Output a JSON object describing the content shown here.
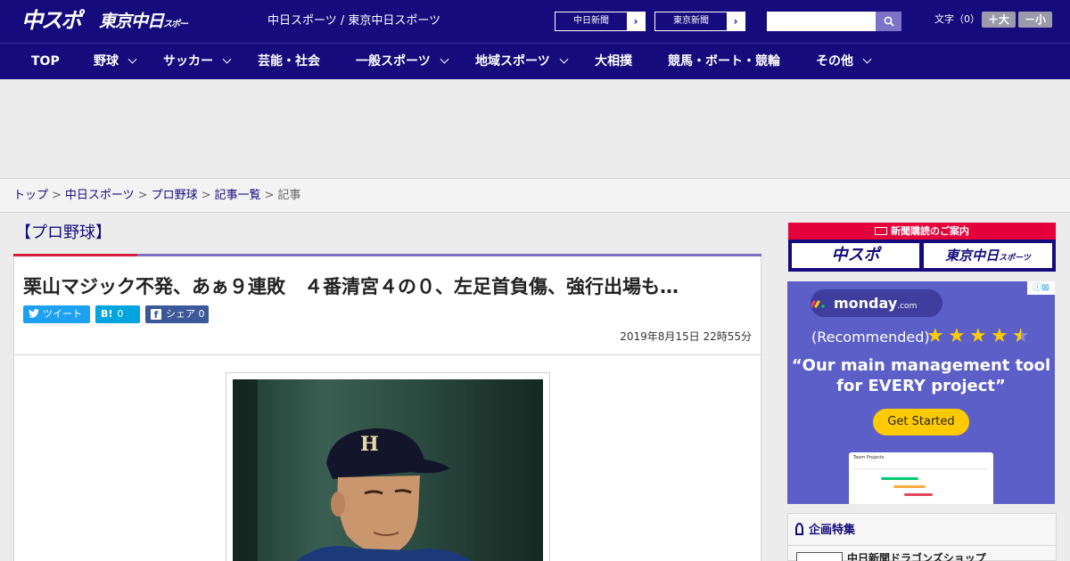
{
  "header": {
    "logo_chuspo": "中スポ",
    "logo_tokyo_main": "東京中日",
    "logo_tokyo_sub": "スポーツ",
    "site_title": "中日スポーツ / 東京中日スポーツ",
    "ext_links": [
      {
        "label": "中日新聞"
      },
      {
        "label": "東京新聞"
      }
    ],
    "search_placeholder": "",
    "search_icon": "search-icon",
    "font_size_label": "文字（0）",
    "font_larger": "＋大",
    "font_smaller": "－小"
  },
  "nav": {
    "items": [
      {
        "label": "TOP",
        "dropdown": false
      },
      {
        "label": "野球",
        "dropdown": true
      },
      {
        "label": "サッカー",
        "dropdown": true
      },
      {
        "label": "芸能・社会",
        "dropdown": false
      },
      {
        "label": "一般スポーツ",
        "dropdown": true
      },
      {
        "label": "地域スポーツ",
        "dropdown": true
      },
      {
        "label": "大相撲",
        "dropdown": false
      },
      {
        "label": "競馬・ボート・競輪",
        "dropdown": false
      },
      {
        "label": "その他",
        "dropdown": true
      }
    ]
  },
  "breadcrumb": {
    "items": [
      "トップ",
      "中日スポーツ",
      "プロ野球",
      "記事一覧"
    ],
    "current": "記事",
    "separator": ">"
  },
  "article": {
    "category": "【プロ野球】",
    "headline": "栗山マジック不発、あぁ９連敗　４番清宮４の０、左足首負傷、強行出場も…",
    "share": {
      "tweet": "ツイート",
      "hatena_icon": "B!",
      "hatena_count": "0",
      "facebook_label": "シェア",
      "facebook_count": "0"
    },
    "date": "2019年8月15日 22時55分"
  },
  "sidebar": {
    "subscribe_bar": "新聞購読のご案内",
    "subscribe_chuspo": "中スポ",
    "subscribe_tokyo_main": "東京中日",
    "subscribe_tokyo_sub": "スポーツ",
    "ad": {
      "brand": "monday",
      "brand_suffix": ".com",
      "recommended": "(Recommended)",
      "stars": 4.5,
      "quote": "“Our main management tool for EVERY project”",
      "cta": "Get Started",
      "card_title": "Team Projects"
    },
    "feature_title": "企画特集",
    "feature_item": "中日新聞ドラゴンズショップ"
  },
  "colors": {
    "brand_navy": "#150b7c",
    "accent_red": "#d71b3b",
    "twitter": "#1da1f2",
    "hatena": "#00a4de",
    "facebook": "#3b5998",
    "monday_bg": "#5b5fc7",
    "monday_cta": "#ffcb00"
  }
}
